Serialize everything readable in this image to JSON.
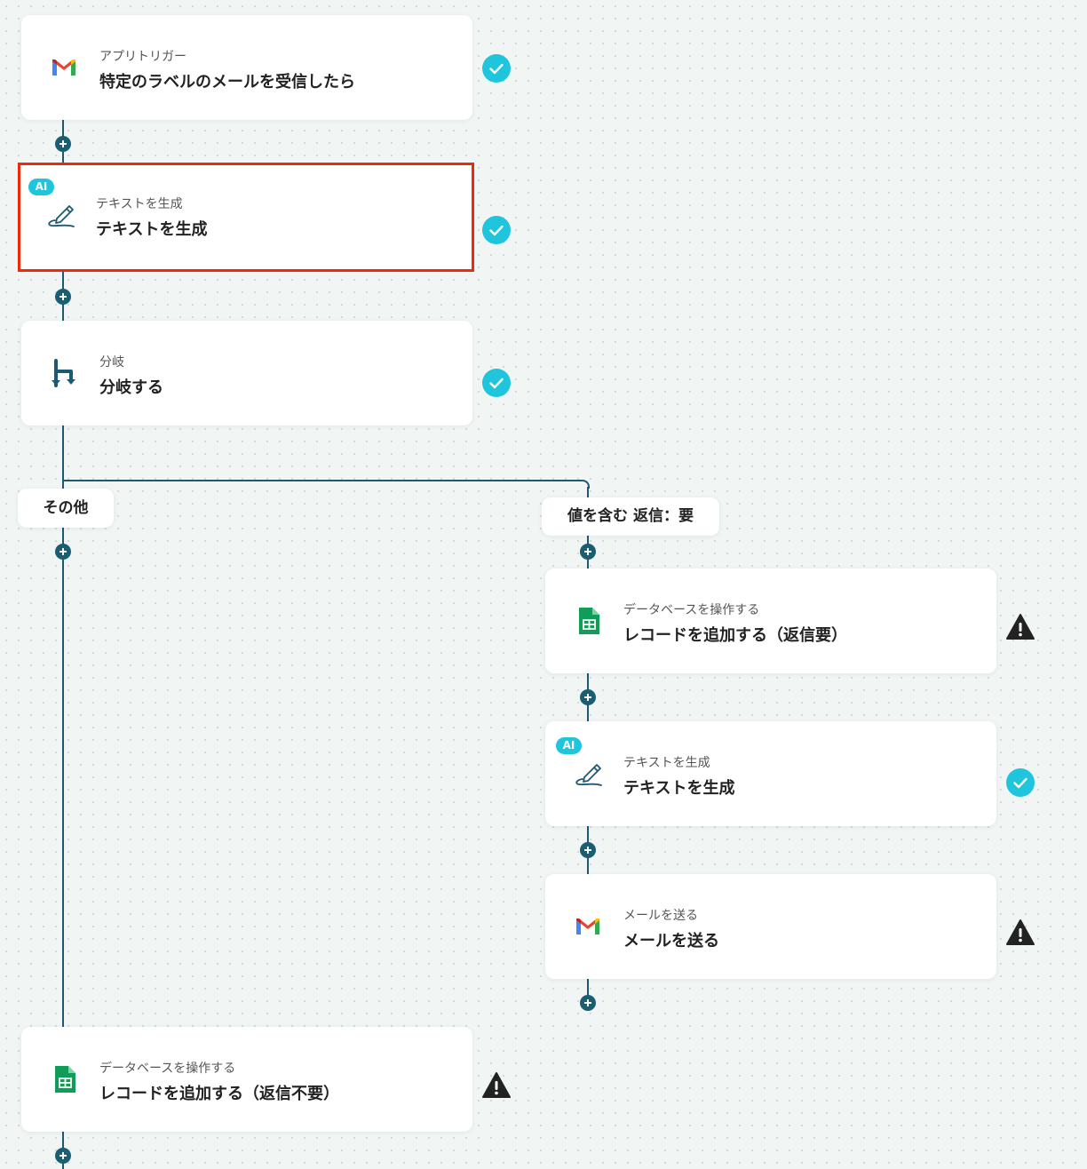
{
  "colors": {
    "connector": "#1d5a72",
    "success": "#1ec5dd",
    "warning": "#222222",
    "selected_border": "#ee2a0b"
  },
  "steps": [
    {
      "id": "trigger",
      "icon": "gmail-icon",
      "small": "アプリトリガー",
      "big": "特定のラベルのメールを受信したら",
      "status": "success"
    },
    {
      "id": "ai1",
      "icon": "pen-icon",
      "ai": "AI",
      "small": "テキストを生成",
      "big": "テキストを生成",
      "status": "success",
      "selected": true
    },
    {
      "id": "branch",
      "icon": "branch-icon",
      "small": "分岐",
      "big": "分岐する",
      "status": "success"
    },
    {
      "id": "db-yes",
      "icon": "sheets-icon",
      "small": "データベースを操作する",
      "big": "レコードを追加する（返信要）",
      "status": "warning"
    },
    {
      "id": "ai2",
      "icon": "pen-icon",
      "ai": "AI",
      "small": "テキストを生成",
      "big": "テキストを生成",
      "status": "success"
    },
    {
      "id": "mail",
      "icon": "gmail-icon",
      "small": "メールを送る",
      "big": "メールを送る",
      "status": "warning"
    },
    {
      "id": "db-no",
      "icon": "sheets-icon",
      "small": "データベースを操作する",
      "big": "レコードを追加する（返信不要）",
      "status": "warning"
    }
  ],
  "branches": {
    "other": "その他",
    "condition": "値を含む 返信：要"
  }
}
